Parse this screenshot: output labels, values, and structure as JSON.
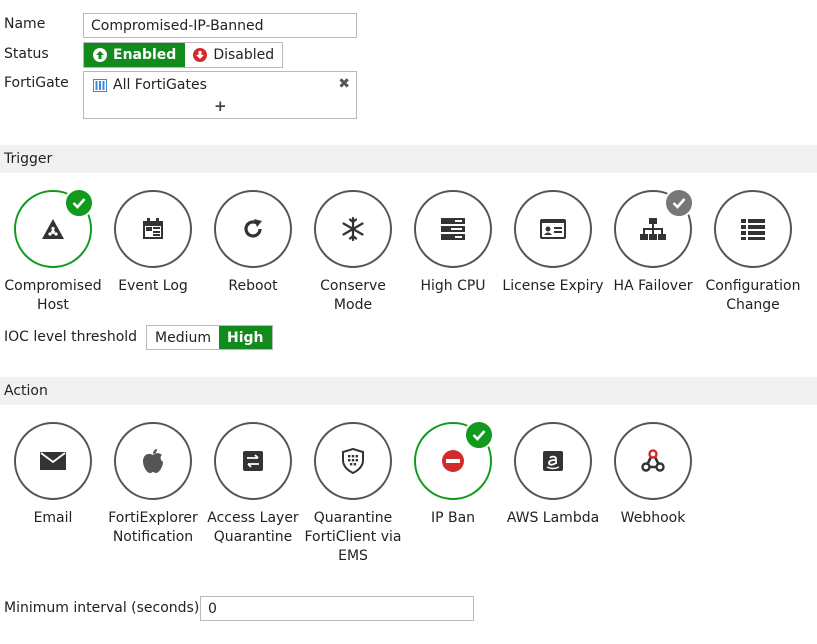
{
  "form": {
    "name_label": "Name",
    "name_value": "Compromised-IP-Banned",
    "status_label": "Status",
    "status_enabled": "Enabled",
    "status_disabled": "Disabled",
    "fortigate_label": "FortiGate",
    "fortigate_value": "All FortiGates",
    "fortigate_add": "+",
    "fortigate_remove": "✖"
  },
  "trigger": {
    "heading": "Trigger",
    "items": [
      {
        "label": "Compromised\nHost",
        "icon": "biohazard-icon",
        "selected": true,
        "badge": "green"
      },
      {
        "label": "Event Log",
        "icon": "event-log-icon"
      },
      {
        "label": "Reboot",
        "icon": "reboot-icon"
      },
      {
        "label": "Conserve\nMode",
        "icon": "snowflake-icon"
      },
      {
        "label": "High CPU",
        "icon": "server-icon"
      },
      {
        "label": "License Expiry",
        "icon": "id-card-icon"
      },
      {
        "label": "HA Failover",
        "icon": "sitemap-icon",
        "badge": "gray"
      },
      {
        "label": "Configuration\nChange",
        "icon": "list-icon"
      }
    ],
    "ioc_label": "IOC level threshold",
    "ioc_medium": "Medium",
    "ioc_high": "High"
  },
  "action": {
    "heading": "Action",
    "items": [
      {
        "label": "Email",
        "icon": "envelope-icon"
      },
      {
        "label": "FortiExplorer\nNotification",
        "icon": "apple-icon"
      },
      {
        "label": "Access Layer\nQuarantine",
        "icon": "exchange-icon"
      },
      {
        "label": "Quarantine\nFortiClient via\nEMS",
        "icon": "shield-keypad-icon"
      },
      {
        "label": "IP Ban",
        "icon": "ban-icon",
        "selected": true,
        "badge": "green"
      },
      {
        "label": "AWS Lambda",
        "icon": "amazon-icon"
      },
      {
        "label": "Webhook",
        "icon": "webhook-icon"
      }
    ],
    "min_interval_label": "Minimum interval (seconds)",
    "min_interval_value": "0"
  },
  "colors": {
    "accent": "#129a1e",
    "section_bg": "#f1f1f1",
    "disabled_red": "#d12b2b"
  }
}
